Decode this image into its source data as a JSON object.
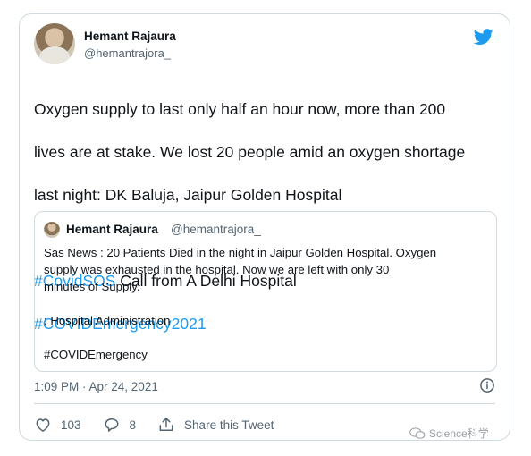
{
  "tweet": {
    "author_name": "Hemant Rajaura",
    "author_handle": "@hemantrajora_",
    "text_line1": "Oxygen supply to last only half an hour now, more than 200",
    "text_line2": "lives are at stake. We lost 20 people amid an oxygen shortage",
    "text_line3": "last night: DK Baluja, Jaipur Golden Hospital",
    "hashtag1": "#CovidSOS",
    "text_after_hashtag1": " Call from A Delhi Hospital",
    "hashtag2": "#COVIDEmergency2021",
    "timestamp": "1:09 PM · Apr 24, 2021",
    "likes": "103",
    "replies": "8",
    "share_label": "Share this Tweet"
  },
  "quote": {
    "author_name": "Hemant Rajaura",
    "author_handle": "@hemantrajora_",
    "line1": "Sas News : 20 Patients Died in the night in Jaipur Golden Hospital. Oxygen",
    "line2": "supply was exhausted in the hospital.  Now we are left with only 30",
    "line3": "minutes of Supply.",
    "line4": ": Hospital Administration",
    "line5": "#COVIDEmergency"
  },
  "watermark": {
    "text": "Science科学"
  },
  "colors": {
    "accent": "#1d9bf0",
    "muted": "#536471",
    "border": "#cfd9de"
  },
  "icons": [
    "twitter-bird-icon",
    "info-icon",
    "heart-icon",
    "reply-icon",
    "share-icon",
    "wechat-icon"
  ]
}
